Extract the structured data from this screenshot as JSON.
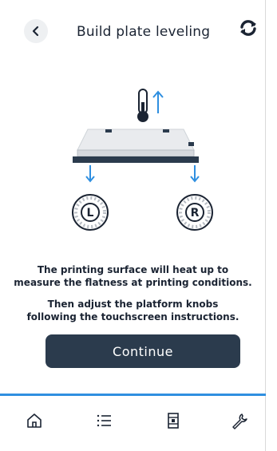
{
  "header": {
    "title": "Build plate leveling",
    "back_icon": "chevron-left-icon",
    "sync_icon": "sync-icon"
  },
  "illustration": {
    "left_knob_label": "L",
    "right_knob_label": "R",
    "thermometer_icon": "thermometer-icon",
    "accent_color": "#2f8fe0"
  },
  "instructions": {
    "line1": "The printing surface will heat up to",
    "line2": "measure the flatness at printing conditions.",
    "line3": "Then adjust the platform knobs",
    "line4": "following the touchscreen instructions."
  },
  "continue_label": "Continue",
  "tabbar": {
    "items": [
      {
        "icon": "home-icon"
      },
      {
        "icon": "list-icon"
      },
      {
        "icon": "printer-icon"
      },
      {
        "icon": "wrench-icon"
      }
    ]
  },
  "colors": {
    "button_bg": "#2b3b4d",
    "divider": "#2f8fe0",
    "text": "#1b2433"
  }
}
